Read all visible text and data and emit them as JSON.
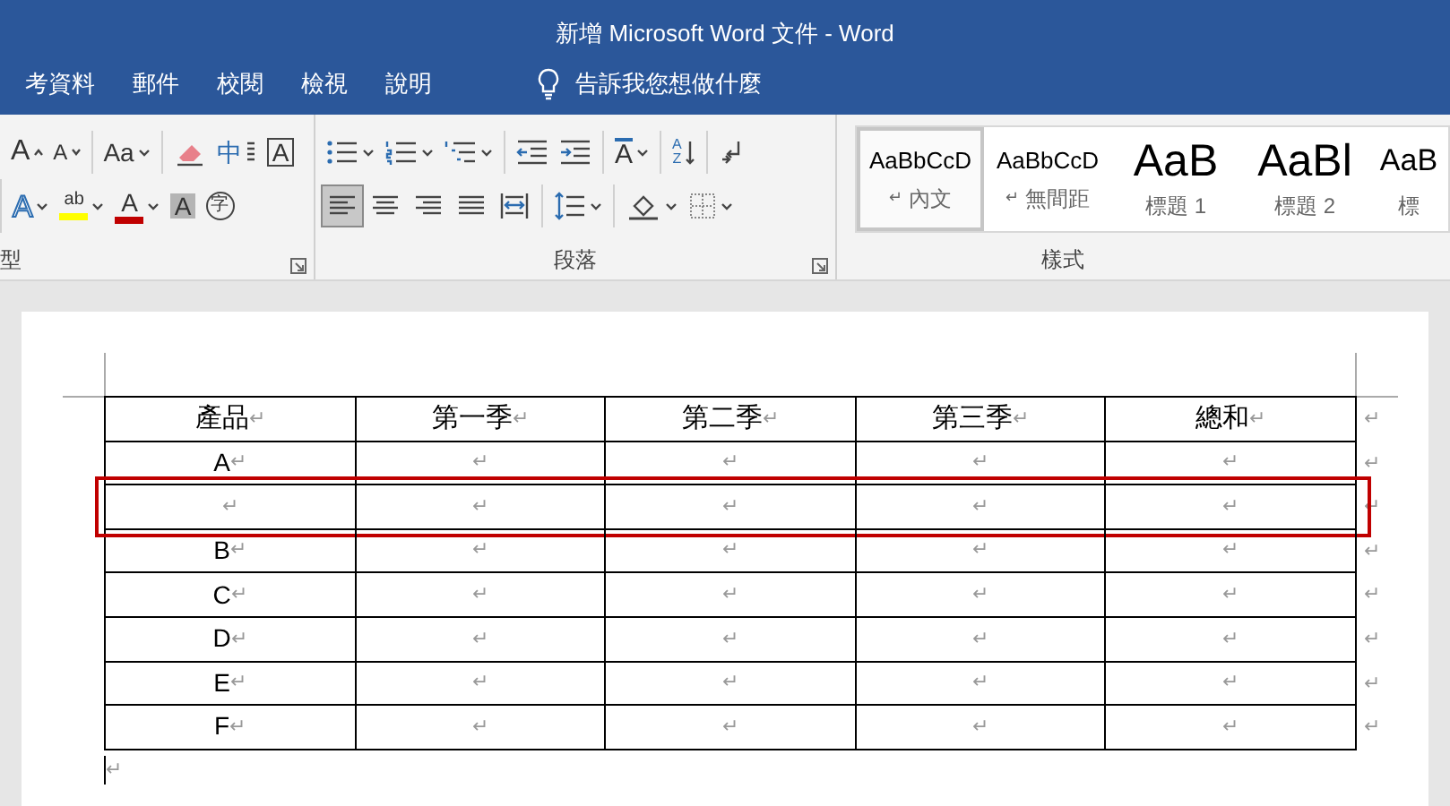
{
  "window": {
    "title": "新增 Microsoft Word 文件 - Word"
  },
  "tabs": [
    {
      "label": "考資料"
    },
    {
      "label": "郵件"
    },
    {
      "label": "校閱"
    },
    {
      "label": "檢視"
    },
    {
      "label": "說明"
    }
  ],
  "tell_me": {
    "placeholder": "告訴我您想做什麼"
  },
  "font_group": {
    "label": "型",
    "row1": [
      [
        {
          "kind": "grow",
          "label": "A",
          "dropdown": false
        },
        {
          "kind": "shrink",
          "label": "A",
          "dropdown": false
        }
      ],
      [
        {
          "kind": "case",
          "label": "Aa",
          "dropdown": true
        }
      ],
      [
        {
          "kind": "clear",
          "dropdown": false
        },
        {
          "kind": "phonetic",
          "label": "中",
          "dropdown": false
        },
        {
          "kind": "char_border",
          "label": "A",
          "dropdown": false
        }
      ]
    ],
    "row2": [
      [
        {
          "kind": "effects",
          "label": "A",
          "dropdown": true
        },
        {
          "kind": "highlight",
          "label": "ab",
          "color": "#ffff00",
          "dropdown": true
        },
        {
          "kind": "font_color",
          "label": "A",
          "color": "#c00000",
          "dropdown": true
        },
        {
          "kind": "char_shading",
          "label": "A",
          "dropdown": false
        },
        {
          "kind": "enclose",
          "label": "字",
          "dropdown": false
        }
      ]
    ]
  },
  "paragraph_group": {
    "label": "段落",
    "row1": [
      [
        {
          "kind": "bullets",
          "dropdown": true
        },
        {
          "kind": "numbering",
          "dropdown": true
        },
        {
          "kind": "multilevel",
          "dropdown": true
        }
      ],
      [
        {
          "kind": "outdent",
          "dropdown": false
        },
        {
          "kind": "indent",
          "dropdown": false
        }
      ],
      [
        {
          "kind": "asian_layout",
          "label": "A",
          "dropdown": true
        }
      ],
      [
        {
          "kind": "sort",
          "label": "A",
          "label_2": "Z",
          "dropdown": false
        }
      ],
      [
        {
          "kind": "show_marks",
          "dropdown": false
        }
      ]
    ],
    "row2": [
      [
        {
          "kind": "align_left",
          "selected": true,
          "dropdown": false
        },
        {
          "kind": "align_center",
          "selected": false,
          "dropdown": false
        },
        {
          "kind": "align_right",
          "selected": false,
          "dropdown": false
        },
        {
          "kind": "justify",
          "selected": false,
          "dropdown": false
        },
        {
          "kind": "distribute",
          "selected": false,
          "dropdown": false
        }
      ],
      [
        {
          "kind": "line_spacing",
          "dropdown": true
        }
      ],
      [
        {
          "kind": "para_shading",
          "dropdown": true
        },
        {
          "kind": "borders",
          "dropdown": true
        }
      ]
    ]
  },
  "styles_group": {
    "label": "樣式",
    "styles": [
      {
        "kind": "body",
        "preview": "AaBbCcD",
        "mark": "↵",
        "name": "內文",
        "selected": true
      },
      {
        "kind": "body",
        "preview": "AaBbCcD",
        "mark": "↵",
        "name": "無間距",
        "selected": false
      },
      {
        "kind": "heading",
        "preview": "AaB",
        "name": "標題 1",
        "selected": false
      },
      {
        "kind": "heading",
        "preview": "AaBl",
        "name": "標題 2",
        "selected": false
      },
      {
        "kind": "subheading",
        "preview": "AaB",
        "name": "標",
        "selected": false
      }
    ]
  },
  "table": {
    "rows": [
      {
        "highlighted": false,
        "end_mark": "↵",
        "cells": [
          {
            "text": "產品",
            "mark": "↵"
          },
          {
            "text": "第一季",
            "mark": "↵"
          },
          {
            "text": "第二季",
            "mark": "↵"
          },
          {
            "text": "第三季",
            "mark": "↵"
          },
          {
            "text": "總和",
            "mark": "↵"
          }
        ]
      },
      {
        "highlighted": false,
        "end_mark": "↵",
        "cells": [
          {
            "text": "A",
            "mark": "↵"
          },
          {
            "mark": "↵"
          },
          {
            "mark": "↵"
          },
          {
            "mark": "↵"
          },
          {
            "mark": "↵"
          }
        ]
      },
      {
        "highlighted": true,
        "end_mark": "↵",
        "cells": [
          {
            "mark": "↵"
          },
          {
            "mark": "↵"
          },
          {
            "mark": "↵"
          },
          {
            "mark": "↵"
          },
          {
            "mark": "↵"
          }
        ]
      },
      {
        "highlighted": false,
        "end_mark": "↵",
        "cells": [
          {
            "text": "B",
            "mark": "↵"
          },
          {
            "mark": "↵"
          },
          {
            "mark": "↵"
          },
          {
            "mark": "↵"
          },
          {
            "mark": "↵"
          }
        ]
      },
      {
        "highlighted": false,
        "end_mark": "↵",
        "cells": [
          {
            "text": "C",
            "mark": "↵"
          },
          {
            "mark": "↵"
          },
          {
            "mark": "↵"
          },
          {
            "mark": "↵"
          },
          {
            "mark": "↵"
          }
        ]
      },
      {
        "highlighted": false,
        "end_mark": "↵",
        "cells": [
          {
            "text": "D",
            "mark": "↵"
          },
          {
            "mark": "↵"
          },
          {
            "mark": "↵"
          },
          {
            "mark": "↵"
          },
          {
            "mark": "↵"
          }
        ]
      },
      {
        "highlighted": false,
        "end_mark": "↵",
        "cells": [
          {
            "text": "E",
            "mark": "↵"
          },
          {
            "mark": "↵"
          },
          {
            "mark": "↵"
          },
          {
            "mark": "↵"
          },
          {
            "mark": "↵"
          }
        ]
      },
      {
        "highlighted": false,
        "end_mark": "↵",
        "cells": [
          {
            "text": "F",
            "mark": "↵"
          },
          {
            "mark": "↵"
          },
          {
            "mark": "↵"
          },
          {
            "mark": "↵"
          },
          {
            "mark": "↵"
          }
        ]
      }
    ]
  },
  "after_table": {
    "mark": "↵"
  }
}
